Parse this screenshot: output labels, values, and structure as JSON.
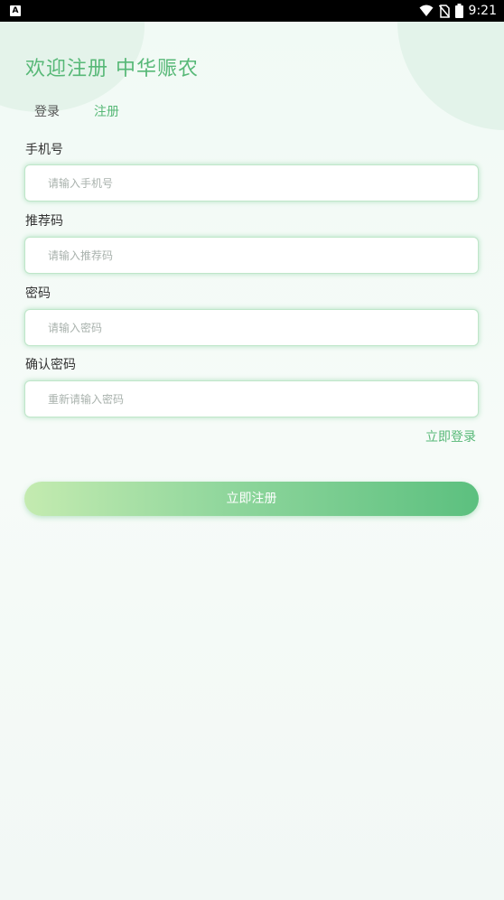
{
  "status_bar": {
    "left_icon": "A",
    "time": "9:21",
    "icons": [
      "wifi-icon",
      "no-sim-icon",
      "battery-icon"
    ]
  },
  "header": {
    "welcome": "欢迎注册 中华赈农"
  },
  "tabs": {
    "login": "登录",
    "register": "注册"
  },
  "form": {
    "phone": {
      "label": "手机号",
      "placeholder": "请输入手机号",
      "value": ""
    },
    "referral": {
      "label": "推荐码",
      "placeholder": "请输入推荐码",
      "value": ""
    },
    "password": {
      "label": "密码",
      "placeholder": "请输入密码",
      "value": ""
    },
    "confirm_password": {
      "label": "确认密码",
      "placeholder": "重新请输入密码",
      "value": ""
    }
  },
  "links": {
    "login_now": "立即登录"
  },
  "actions": {
    "register_now": "立即注册"
  },
  "colors": {
    "accent": "#57b877",
    "field_border": "#bfe6c9",
    "button_start": "#c4ebb0",
    "button_end": "#5cc07f"
  }
}
